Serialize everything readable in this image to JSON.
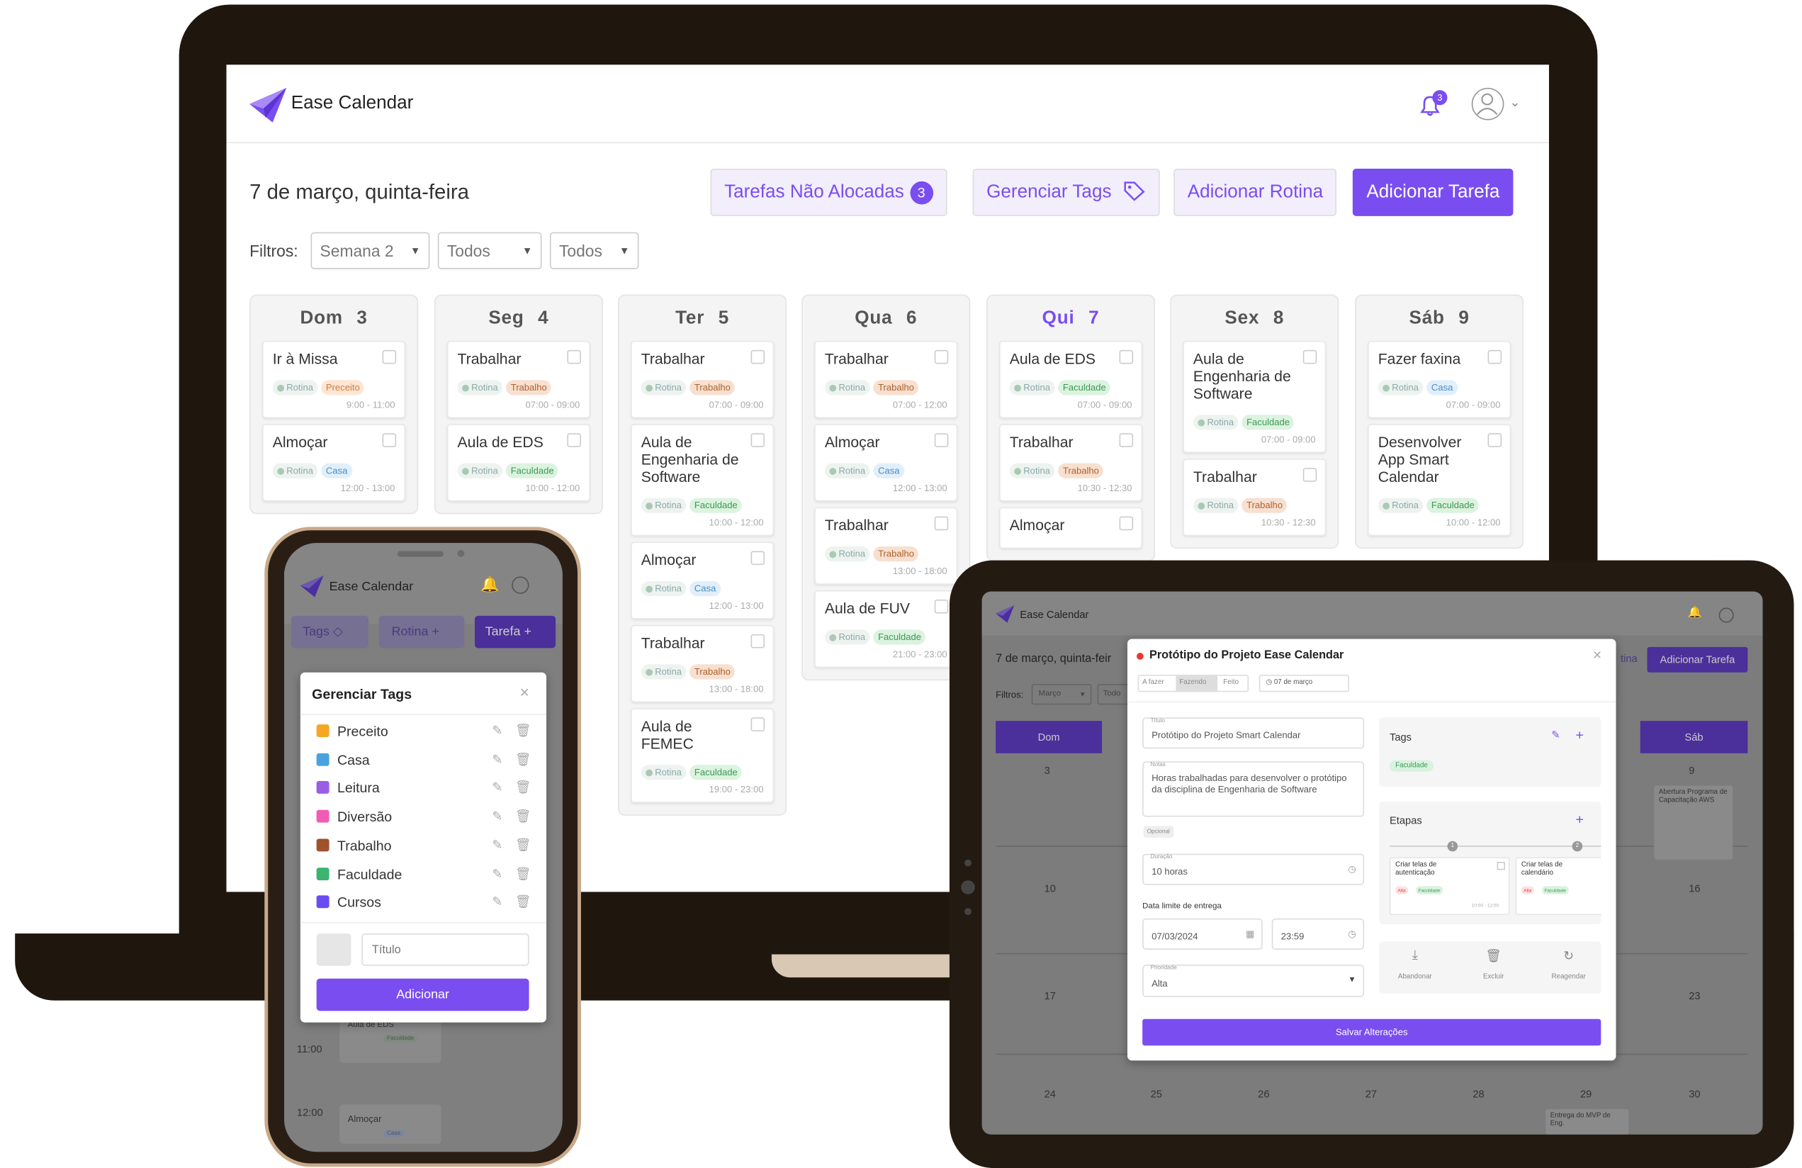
{
  "app": {
    "name": "Ease Calendar",
    "notifications": "3"
  },
  "desktop": {
    "date_title": "7 de março, quinta-feira",
    "toolbar": {
      "unallocated": "Tarefas Não Alocadas",
      "unallocated_count": "3",
      "manage_tags": "Gerenciar Tags",
      "add_routine": "Adicionar Rotina",
      "add_task": "Adicionar Tarefa"
    },
    "filters": {
      "label": "Filtros:",
      "week": "Semana 2",
      "f2": "Todos",
      "f3": "Todos"
    },
    "days": [
      {
        "name": "Dom",
        "num": "3",
        "cards": [
          {
            "title": "Ir à Missa",
            "tag": "Preceito",
            "time": "9:00 - 11:00"
          },
          {
            "title": "Almoçar",
            "tag": "Casa",
            "time": "12:00 - 13:00"
          }
        ]
      },
      {
        "name": "Seg",
        "num": "4",
        "cards": [
          {
            "title": "Trabalhar",
            "tag": "Trabalho",
            "time": "07:00 - 09:00"
          },
          {
            "title": "Aula de EDS",
            "tag": "Faculdade",
            "time": "10:00 - 12:00"
          }
        ]
      },
      {
        "name": "Ter",
        "num": "5",
        "cards": [
          {
            "title": "Trabalhar",
            "tag": "Trabalho",
            "time": "07:00 - 09:00"
          },
          {
            "title": "Aula de Engenharia de Software",
            "tag": "Faculdade",
            "time": "10:00 - 12:00"
          },
          {
            "title": "Almoçar",
            "tag": "Casa",
            "time": "12:00 - 13:00"
          },
          {
            "title": "Trabalhar",
            "tag": "Trabalho",
            "time": "13:00 - 18:00"
          },
          {
            "title": "Aula de FEMEC",
            "tag": "Faculdade",
            "time": "19:00 - 23:00"
          }
        ]
      },
      {
        "name": "Qua",
        "num": "6",
        "cards": [
          {
            "title": "Trabalhar",
            "tag": "Trabalho",
            "time": "07:00 - 12:00"
          },
          {
            "title": "Almoçar",
            "tag": "Casa",
            "time": "12:00 - 13:00"
          },
          {
            "title": "Trabalhar",
            "tag": "Trabalho",
            "time": "13:00 - 18:00"
          },
          {
            "title": "Aula de FUV",
            "tag": "Faculdade",
            "time": "21:00 - 23:00"
          }
        ]
      },
      {
        "name": "Qui",
        "num": "7",
        "cards": [
          {
            "title": "Aula de EDS",
            "tag": "Faculdade",
            "time": "07:00 - 09:00"
          },
          {
            "title": "Trabalhar",
            "tag": "Trabalho",
            "time": "10:30 - 12:30"
          },
          {
            "title": "Almoçar",
            "tag": "",
            "time": ""
          }
        ]
      },
      {
        "name": "Sex",
        "num": "8",
        "cards": [
          {
            "title": "Aula de Engenharia de Software",
            "tag": "Faculdade",
            "time": "07:00 - 09:00"
          },
          {
            "title": "Trabalhar",
            "tag": "Trabalho",
            "time": "10:30 - 12:30"
          }
        ]
      },
      {
        "name": "Sáb",
        "num": "9",
        "cards": [
          {
            "title": "Fazer faxina",
            "tag": "Casa",
            "time": "07:00 - 09:00"
          },
          {
            "title": "Desenvolver App Smart Calendar",
            "tag": "Faculdade",
            "time": "10:00 - 12:00"
          }
        ]
      }
    ],
    "routine_tag": "Rotina"
  },
  "phone": {
    "toolbar": {
      "tags": "Tags",
      "routine": "Rotina",
      "task": "Tarefa"
    },
    "modal": {
      "title": "Gerenciar Tags",
      "tags": [
        {
          "name": "Preceito",
          "color": "#f5a623"
        },
        {
          "name": "Casa",
          "color": "#4aa3df"
        },
        {
          "name": "Leitura",
          "color": "#9b5de5"
        },
        {
          "name": "Diversão",
          "color": "#f15bb5"
        },
        {
          "name": "Trabalho",
          "color": "#a0522d"
        },
        {
          "name": "Faculdade",
          "color": "#3cb371"
        },
        {
          "name": "Cursos",
          "color": "#6a4cf0"
        }
      ],
      "title_placeholder": "Título",
      "add_label": "Adicionar"
    },
    "background": {
      "times": [
        "11:00",
        "12:00"
      ],
      "item1": "Aula de EDS",
      "item2": "Almoçar",
      "tag_faculdade": "Faculdade",
      "tag_casa": "Casa"
    }
  },
  "tablet": {
    "bg": {
      "date_title": "7 de março, quinta-feir",
      "filters_label": "Filtros:",
      "filter_value": "Março",
      "filter2": "Todo",
      "add_task": "Adicionar Tarefa",
      "routine_partial": "tina",
      "col_dom": "Dom",
      "col_sab": "Sáb",
      "nums_left": [
        "3",
        "10",
        "17",
        "24"
      ],
      "nums_right": [
        "9",
        "16",
        "23",
        "30"
      ],
      "nums_bottom": [
        "25",
        "26",
        "27",
        "28",
        "29"
      ],
      "event_sab": "Abertura Programa de Capacitação AWS",
      "event_29": "Entrega do MVP de Eng."
    },
    "modal": {
      "title": "Protótipo do Projeto Ease Calendar",
      "status": [
        "A fazer",
        "Fazendo",
        "Feito"
      ],
      "date_chip": "07 de março",
      "title_label": "Título",
      "title_value": "Protótipo do Projeto Smart Calendar",
      "notes_label": "Notas",
      "notes_value": "Horas trabalhadas para desenvolver o protótipo da disciplina de Engenharia de Software",
      "optional": "Opcional",
      "duration_label": "Duração",
      "duration_value": "10 horas",
      "deadline_label": "Data limite de entrega",
      "deadline_date": "07/03/2024",
      "deadline_time": "23:59",
      "priority_label": "Prioridade",
      "priority_value": "Alta",
      "tags_title": "Tags",
      "tag_value": "Faculdade",
      "stages_title": "Etapas",
      "stages": [
        {
          "title": "Criar telas de autenticação",
          "time": "10:00 - 12:00"
        },
        {
          "title": "Criar telas de calendário",
          "time": ""
        }
      ],
      "stage_tag_priority": "Alta",
      "stage_tag": "Faculdade",
      "stage_nums": [
        "1",
        "2"
      ],
      "actions": [
        "Abandonar",
        "Excluir",
        "Reagendar"
      ],
      "save": "Salvar Alterações"
    }
  },
  "colors": {
    "accent": "#7a4df0",
    "device": "#1f160e"
  }
}
